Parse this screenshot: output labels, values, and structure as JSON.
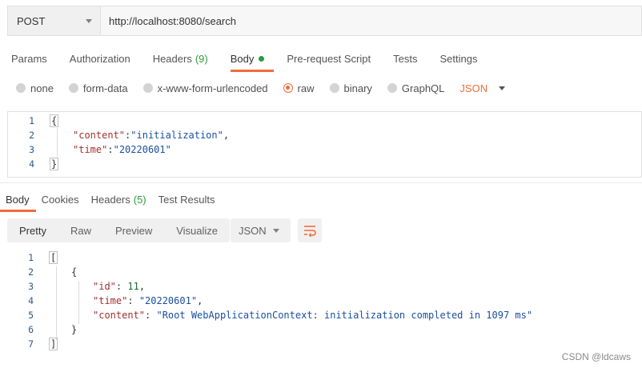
{
  "request": {
    "method": "POST",
    "url": "http://localhost:8080/search"
  },
  "request_tabs": [
    {
      "label": "Params"
    },
    {
      "label": "Authorization"
    },
    {
      "label": "Headers",
      "count": "(9)"
    },
    {
      "label": "Body",
      "active": true,
      "indicator": "green-dot"
    },
    {
      "label": "Pre-request Script"
    },
    {
      "label": "Tests"
    },
    {
      "label": "Settings"
    }
  ],
  "body_types": {
    "options": [
      "none",
      "form-data",
      "x-www-form-urlencoded",
      "raw",
      "binary",
      "GraphQL"
    ],
    "selected": "raw",
    "language": "JSON"
  },
  "request_body": {
    "line_numbers": [
      "1",
      "2",
      "3",
      "4"
    ],
    "open": "{",
    "line2_key": "\"content\"",
    "line2_sep": ":",
    "line2_val": "\"initialization\"",
    "line2_end": ",",
    "line3_key": "\"time\"",
    "line3_sep": ":",
    "line3_val": "\"20220601\"",
    "close": "}"
  },
  "response_tabs": [
    {
      "label": "Body",
      "active": true
    },
    {
      "label": "Cookies"
    },
    {
      "label": "Headers",
      "count": "(5)"
    },
    {
      "label": "Test Results"
    }
  ],
  "view_modes": [
    "Pretty",
    "Raw",
    "Preview",
    "Visualize"
  ],
  "view_selected": "Pretty",
  "format": "JSON",
  "response_body": {
    "line_numbers": [
      "1",
      "2",
      "3",
      "4",
      "5",
      "6",
      "7"
    ],
    "open_array": "[",
    "open_obj": "{",
    "id_key": "\"id\"",
    "id_val": "11",
    "time_key": "\"time\"",
    "time_val": "\"20220601\"",
    "content_key": "\"content\"",
    "content_val": "\"Root WebApplicationContext: initialization completed in 1097 ms\"",
    "colon": ": ",
    "comma": ",",
    "close_obj": "}",
    "close_array": "]"
  },
  "watermark": "CSDN @ldcaws",
  "colors": {
    "accent": "#f26b3a",
    "count_green": "#2e9a3b",
    "json_key": "#a0312e",
    "json_string": "#1b4fa0",
    "json_number": "#1b6b3a"
  }
}
